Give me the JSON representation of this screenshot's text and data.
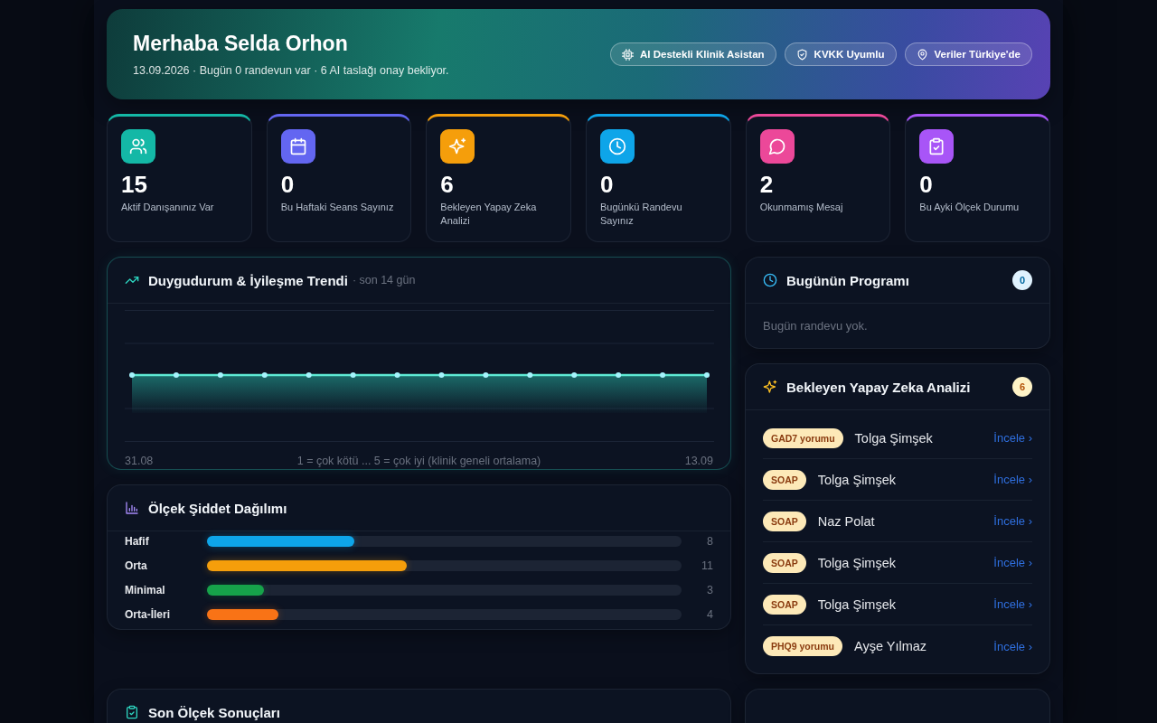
{
  "hero": {
    "title": "Merhaba Selda Orhon",
    "subtitle": "13.09.2026 · Bugün 0 randevun var · 6 AI taslağı onay bekliyor.",
    "badges": [
      "AI Destekli Klinik Asistan",
      "KVKK Uyumlu",
      "Veriler Türkiye'de"
    ]
  },
  "stats": [
    {
      "value": "15",
      "label": "Aktif Danışanınız Var",
      "color": "#14b8a6"
    },
    {
      "value": "0",
      "label": "Bu Haftaki Seans Sayınız",
      "color": "#6366f1"
    },
    {
      "value": "6",
      "label": "Bekleyen Yapay Zeka Analizi",
      "color": "#f59e0b"
    },
    {
      "value": "0",
      "label": "Bugünkü Randevu Sayınız",
      "color": "#0ea5e9"
    },
    {
      "value": "2",
      "label": "Okunmamış Mesaj",
      "color": "#ec4899"
    },
    {
      "value": "0",
      "label": "Bu Ayki Ölçek Durumu",
      "color": "#a855f7"
    }
  ],
  "trend": {
    "title": "Duygudurum & İyileşme Trendi",
    "subtitle": "· son 14 gün",
    "x_start": "31.08",
    "caption": "1 = çok kötü ... 5 = çok iyi (klinik geneli ortalama)",
    "x_end": "13.09"
  },
  "severity": {
    "title": "Ölçek Şiddet Dağılımı",
    "rows": [
      {
        "label": "Hafif",
        "level": 0.31,
        "value": "8",
        "color": "#0ea5e9"
      },
      {
        "label": "Orta",
        "level": 0.42,
        "value": "11",
        "color": "#f59e0b"
      },
      {
        "label": "Minimal",
        "level": 0.12,
        "value": "3",
        "color": "#16a34a"
      },
      {
        "label": "Orta-İleri",
        "level": 0.15,
        "value": "4",
        "color": "#f97316"
      }
    ]
  },
  "recent_results": {
    "title": "Son Ölçek Sonuçları"
  },
  "schedule": {
    "title": "Bugünün Programı",
    "count": "0",
    "empty_text": "Bugün randevu yok."
  },
  "ai_analysis": {
    "title": "Bekleyen Yapay Zeka Analizi",
    "count": "6",
    "items": [
      {
        "tag": "GAD7 yorumu",
        "name": "Tolga Şimşek",
        "action": "İncele ›"
      },
      {
        "tag": "SOAP",
        "name": "Tolga Şimşek",
        "action": "İncele ›"
      },
      {
        "tag": "SOAP",
        "name": "Naz Polat",
        "action": "İncele ›"
      },
      {
        "tag": "SOAP",
        "name": "Tolga Şimşek",
        "action": "İncele ›"
      },
      {
        "tag": "SOAP",
        "name": "Tolga Şimşek",
        "action": "İncele ›"
      },
      {
        "tag": "PHQ9 yorumu",
        "name": "Ayşe Yılmaz",
        "action": "İncele ›"
      }
    ]
  }
}
